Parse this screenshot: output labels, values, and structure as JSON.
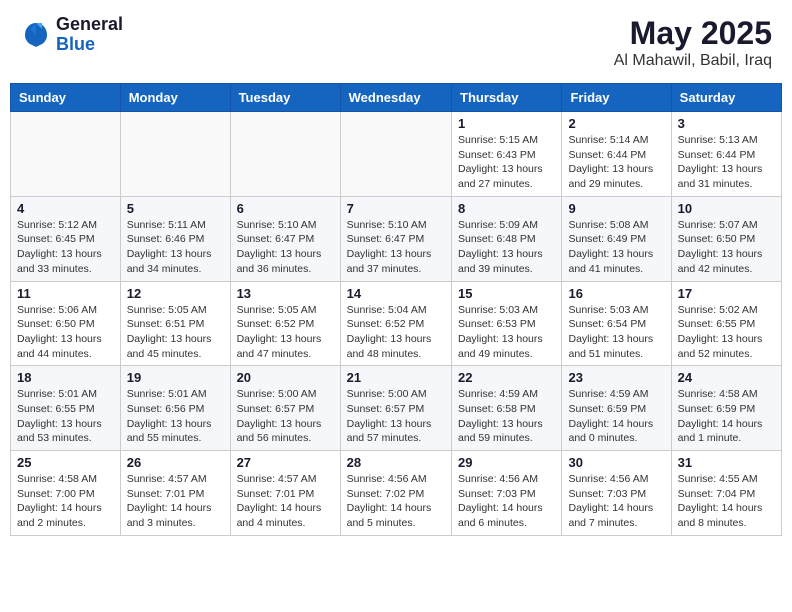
{
  "header": {
    "logo_general": "General",
    "logo_blue": "Blue",
    "month_title": "May 2025",
    "location": "Al Mahawil, Babil, Iraq"
  },
  "days_of_week": [
    "Sunday",
    "Monday",
    "Tuesday",
    "Wednesday",
    "Thursday",
    "Friday",
    "Saturday"
  ],
  "weeks": [
    [
      {
        "day": "",
        "info": ""
      },
      {
        "day": "",
        "info": ""
      },
      {
        "day": "",
        "info": ""
      },
      {
        "day": "",
        "info": ""
      },
      {
        "day": "1",
        "info": "Sunrise: 5:15 AM\nSunset: 6:43 PM\nDaylight: 13 hours\nand 27 minutes."
      },
      {
        "day": "2",
        "info": "Sunrise: 5:14 AM\nSunset: 6:44 PM\nDaylight: 13 hours\nand 29 minutes."
      },
      {
        "day": "3",
        "info": "Sunrise: 5:13 AM\nSunset: 6:44 PM\nDaylight: 13 hours\nand 31 minutes."
      }
    ],
    [
      {
        "day": "4",
        "info": "Sunrise: 5:12 AM\nSunset: 6:45 PM\nDaylight: 13 hours\nand 33 minutes."
      },
      {
        "day": "5",
        "info": "Sunrise: 5:11 AM\nSunset: 6:46 PM\nDaylight: 13 hours\nand 34 minutes."
      },
      {
        "day": "6",
        "info": "Sunrise: 5:10 AM\nSunset: 6:47 PM\nDaylight: 13 hours\nand 36 minutes."
      },
      {
        "day": "7",
        "info": "Sunrise: 5:10 AM\nSunset: 6:47 PM\nDaylight: 13 hours\nand 37 minutes."
      },
      {
        "day": "8",
        "info": "Sunrise: 5:09 AM\nSunset: 6:48 PM\nDaylight: 13 hours\nand 39 minutes."
      },
      {
        "day": "9",
        "info": "Sunrise: 5:08 AM\nSunset: 6:49 PM\nDaylight: 13 hours\nand 41 minutes."
      },
      {
        "day": "10",
        "info": "Sunrise: 5:07 AM\nSunset: 6:50 PM\nDaylight: 13 hours\nand 42 minutes."
      }
    ],
    [
      {
        "day": "11",
        "info": "Sunrise: 5:06 AM\nSunset: 6:50 PM\nDaylight: 13 hours\nand 44 minutes."
      },
      {
        "day": "12",
        "info": "Sunrise: 5:05 AM\nSunset: 6:51 PM\nDaylight: 13 hours\nand 45 minutes."
      },
      {
        "day": "13",
        "info": "Sunrise: 5:05 AM\nSunset: 6:52 PM\nDaylight: 13 hours\nand 47 minutes."
      },
      {
        "day": "14",
        "info": "Sunrise: 5:04 AM\nSunset: 6:52 PM\nDaylight: 13 hours\nand 48 minutes."
      },
      {
        "day": "15",
        "info": "Sunrise: 5:03 AM\nSunset: 6:53 PM\nDaylight: 13 hours\nand 49 minutes."
      },
      {
        "day": "16",
        "info": "Sunrise: 5:03 AM\nSunset: 6:54 PM\nDaylight: 13 hours\nand 51 minutes."
      },
      {
        "day": "17",
        "info": "Sunrise: 5:02 AM\nSunset: 6:55 PM\nDaylight: 13 hours\nand 52 minutes."
      }
    ],
    [
      {
        "day": "18",
        "info": "Sunrise: 5:01 AM\nSunset: 6:55 PM\nDaylight: 13 hours\nand 53 minutes."
      },
      {
        "day": "19",
        "info": "Sunrise: 5:01 AM\nSunset: 6:56 PM\nDaylight: 13 hours\nand 55 minutes."
      },
      {
        "day": "20",
        "info": "Sunrise: 5:00 AM\nSunset: 6:57 PM\nDaylight: 13 hours\nand 56 minutes."
      },
      {
        "day": "21",
        "info": "Sunrise: 5:00 AM\nSunset: 6:57 PM\nDaylight: 13 hours\nand 57 minutes."
      },
      {
        "day": "22",
        "info": "Sunrise: 4:59 AM\nSunset: 6:58 PM\nDaylight: 13 hours\nand 59 minutes."
      },
      {
        "day": "23",
        "info": "Sunrise: 4:59 AM\nSunset: 6:59 PM\nDaylight: 14 hours\nand 0 minutes."
      },
      {
        "day": "24",
        "info": "Sunrise: 4:58 AM\nSunset: 6:59 PM\nDaylight: 14 hours\nand 1 minute."
      }
    ],
    [
      {
        "day": "25",
        "info": "Sunrise: 4:58 AM\nSunset: 7:00 PM\nDaylight: 14 hours\nand 2 minutes."
      },
      {
        "day": "26",
        "info": "Sunrise: 4:57 AM\nSunset: 7:01 PM\nDaylight: 14 hours\nand 3 minutes."
      },
      {
        "day": "27",
        "info": "Sunrise: 4:57 AM\nSunset: 7:01 PM\nDaylight: 14 hours\nand 4 minutes."
      },
      {
        "day": "28",
        "info": "Sunrise: 4:56 AM\nSunset: 7:02 PM\nDaylight: 14 hours\nand 5 minutes."
      },
      {
        "day": "29",
        "info": "Sunrise: 4:56 AM\nSunset: 7:03 PM\nDaylight: 14 hours\nand 6 minutes."
      },
      {
        "day": "30",
        "info": "Sunrise: 4:56 AM\nSunset: 7:03 PM\nDaylight: 14 hours\nand 7 minutes."
      },
      {
        "day": "31",
        "info": "Sunrise: 4:55 AM\nSunset: 7:04 PM\nDaylight: 14 hours\nand 8 minutes."
      }
    ]
  ]
}
